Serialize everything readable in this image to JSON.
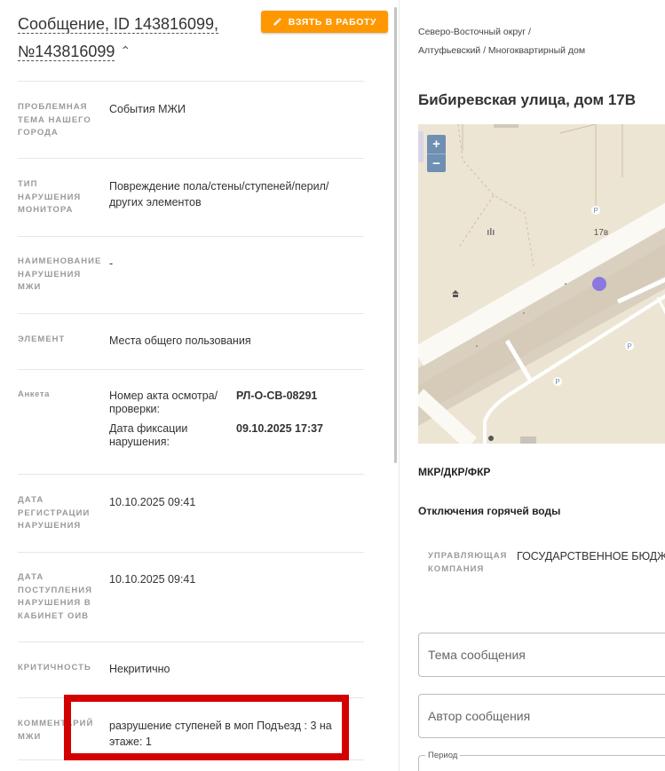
{
  "header": {
    "title_line1": "Сообщение, ID 143816099,",
    "title_line2": "№143816099",
    "take_button_label": "ВЗЯТЬ В РАБОТУ"
  },
  "fields": [
    {
      "label": "ПРОБЛЕМНАЯ ТЕМА НАШЕГО ГОРОДА",
      "value": "События МЖИ"
    },
    {
      "label": "ТИП НАРУШЕНИЯ МОНИТОРА",
      "value": "Повреждение пола/стены/ступеней/перил/других элементов"
    },
    {
      "label": "НАИМЕНОВАНИЕ НАРУШЕНИЯ МЖИ",
      "value": "-"
    },
    {
      "label": "ЭЛЕМЕНТ",
      "value": "Места общего пользования"
    },
    {
      "label": "ДАТА РЕГИСТРАЦИИ НАРУШЕНИЯ",
      "value": "10.10.2025 09:41"
    },
    {
      "label": "ДАТА ПОСТУПЛЕНИЯ НАРУШЕНИЯ В КАБИНЕТ ОИВ",
      "value": "10.10.2025 09:41"
    },
    {
      "label": "КРИТИЧНОСТЬ",
      "value": "Некритично"
    },
    {
      "label": "КОММЕНТАРИЙ МЖИ",
      "value": "разрушение ступеней в моп Подъезд : 3 на этаже: 1"
    }
  ],
  "anketa": {
    "label": "Анкета",
    "rows": [
      {
        "key": "Номер акта осмотра/проверки:",
        "value": "РЛ-О-СВ-08291"
      },
      {
        "key": "Дата фиксации нарушения:",
        "value": "09.10.2025 17:37"
      }
    ]
  },
  "location": {
    "breadcrumb": "Северо-Восточный округ / Алтуфьевский / Многоквартирный дом",
    "address": "Бибиревская улица, дом 17В"
  },
  "map": {
    "building_label": "17в",
    "parking_label": "P",
    "zoom_in": "+",
    "zoom_out": "−",
    "marker_color": "#8a78e0"
  },
  "right_panel": {
    "mkr_label": "МКР/ДКР/ФКР",
    "hot_water_label": "Отключения горячей воды",
    "uk_label": "УПРАВЛЯЮЩАЯ КОМПАНИЯ",
    "uk_value": "ГОСУДАРСТВЕННОЕ БЮДЖЕТНОЕ УЧРЕЖДЕНИЕ ГОРОДА МОСКВЫ «ЖИЛИЩНИК АЛТУФЬЕВСКОГО РАЙОНА»"
  },
  "form": {
    "topic_placeholder": "Тема сообщения",
    "author_placeholder": "Автор сообщения",
    "period_label": "Период"
  },
  "colors": {
    "accent": "#ff9800",
    "highlight": "#d40000",
    "map_bg": "#ede5d3"
  },
  "icons": {
    "take_button": "pencil-icon",
    "title_toggle": "chevron-up-icon"
  }
}
